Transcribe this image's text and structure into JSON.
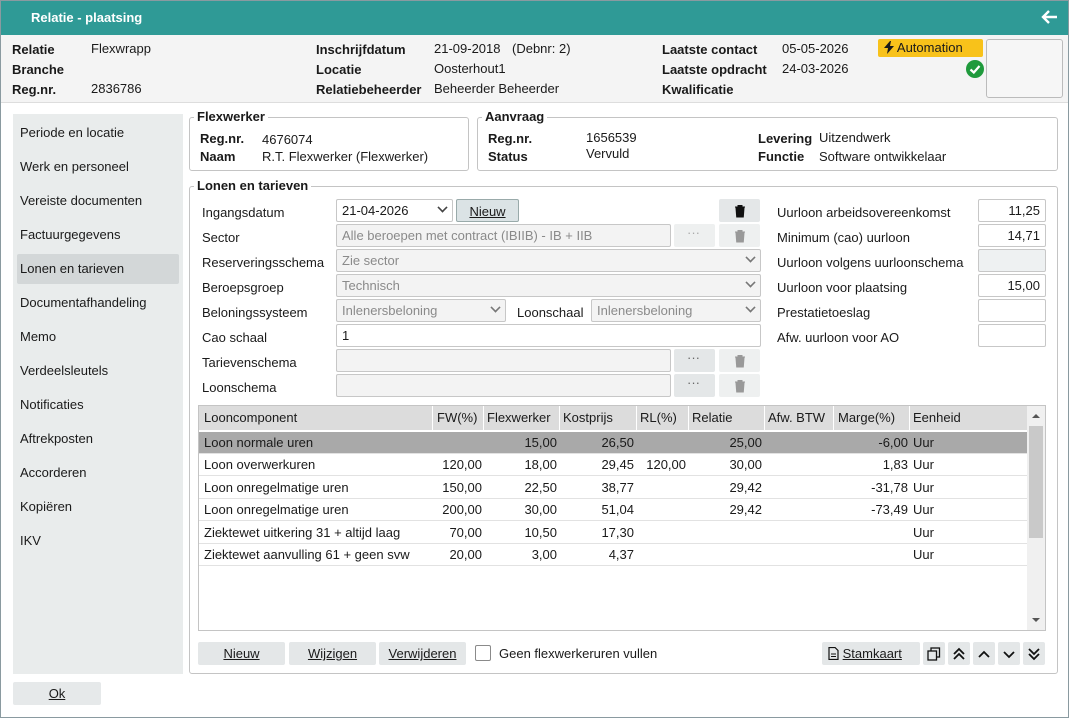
{
  "window": {
    "title": "Relatie - plaatsing"
  },
  "header": {
    "relatie_label": "Relatie",
    "relatie_value": "Flexwrapp",
    "branche_label": "Branche",
    "branche_value": "",
    "regnr_label": "Reg.nr.",
    "regnr_value": "2836786",
    "inschrijfdatum_label": "Inschrijfdatum",
    "inschrijfdatum_value": "21-09-2018",
    "debnr": "(Debnr: 2)",
    "locatie_label": "Locatie",
    "locatie_value": "Oosterhout1",
    "relatiebeheerder_label": "Relatiebeheerder",
    "relatiebeheerder_value": "Beheerder Beheerder",
    "laatste_contact_label": "Laatste contact",
    "laatste_contact_value": "05-05-2026",
    "laatste_opdracht_label": "Laatste opdracht",
    "laatste_opdracht_value": "24-03-2026",
    "kwalificatie_label": "Kwalificatie",
    "kwalificatie_value": "",
    "automation_label": "Automation"
  },
  "sidebar": {
    "items": [
      {
        "label": "Periode en locatie"
      },
      {
        "label": "Werk en personeel"
      },
      {
        "label": "Vereiste documenten"
      },
      {
        "label": "Factuurgegevens"
      },
      {
        "label": "Lonen en tarieven"
      },
      {
        "label": "Documentafhandeling"
      },
      {
        "label": "Memo"
      },
      {
        "label": "Verdeelsleutels"
      },
      {
        "label": "Notificaties"
      },
      {
        "label": "Aftrekposten"
      },
      {
        "label": "Accorderen"
      },
      {
        "label": "Kopiëren"
      },
      {
        "label": "IKV"
      }
    ],
    "ok_label": "Ok"
  },
  "flexwerker": {
    "legend": "Flexwerker",
    "regnr_label": "Reg.nr.",
    "regnr_value": "4676074",
    "naam_label": "Naam",
    "naam_value": "R.T. Flexwerker (Flexwerker)"
  },
  "aanvraag": {
    "legend": "Aanvraag",
    "regnr_label": "Reg.nr.",
    "regnr_value": "1656539",
    "status_label": "Status",
    "status_value": "Vervuld",
    "levering_label": "Levering",
    "levering_value": "Uitzendwerk",
    "functie_label": "Functie",
    "functie_value": "Software ontwikkelaar"
  },
  "lonen": {
    "legend": "Lonen en tarieven",
    "ingangsdatum_label": "Ingangsdatum",
    "ingangsdatum_value": "21-04-2026",
    "nieuw_label": "Nieuw",
    "sector_label": "Sector",
    "sector_value": "Alle beroepen met contract (IBIIB) - IB + IIB",
    "reservering_label": "Reserveringsschema",
    "reservering_value": "Zie sector",
    "beroepsgroep_label": "Beroepsgroep",
    "beroepsgroep_value": "Technisch",
    "beloning_label": "Beloningssysteem",
    "beloning_value": "Inlenersbeloning",
    "loonschaal_label": "Loonschaal",
    "loonschaal_value": "Inlenersbeloning",
    "cao_schaal_label": "Cao schaal",
    "cao_schaal_value": "1",
    "tarieven_label": "Tarievenschema",
    "tarieven_value": "",
    "loonschema_label": "Loonschema",
    "loonschema_value": "",
    "ellipsis": "···",
    "uurloon_cao_label": "Uurloon arbeidsovereenkomst",
    "uurloon_cao_value": "11,25",
    "minimum_label": "Minimum (cao) uurloon",
    "minimum_value": "14,71",
    "uurloon_schema_label": "Uurloon volgens uurloonschema",
    "uurloon_schema_value": "",
    "uurloon_plaatsing_label": "Uurloon voor plaatsing",
    "uurloon_plaatsing_value": "15,00",
    "prestatie_label": "Prestatietoeslag",
    "prestatie_value": "",
    "afw_label": "Afw. uurloon voor AO",
    "afw_value": ""
  },
  "table": {
    "columns": [
      "Looncomponent",
      "FW(%)",
      "Flexwerker",
      "Kostprijs",
      "RL(%)",
      "Relatie",
      "Afw. BTW",
      "Marge(%)",
      "Eenheid"
    ],
    "rows": [
      [
        "Loon normale uren",
        "",
        "15,00",
        "26,50",
        "",
        "25,00",
        "",
        "-6,00",
        "Uur"
      ],
      [
        "Loon overwerkuren",
        "120,00",
        "18,00",
        "29,45",
        "120,00",
        "30,00",
        "",
        "1,83",
        "Uur"
      ],
      [
        "Loon onregelmatige uren",
        "150,00",
        "22,50",
        "38,77",
        "",
        "29,42",
        "",
        "-31,78",
        "Uur"
      ],
      [
        "Loon onregelmatige uren",
        "200,00",
        "30,00",
        "51,04",
        "",
        "29,42",
        "",
        "-73,49",
        "Uur"
      ],
      [
        "Ziektewet uitkering 31 + altijd laag",
        "70,00",
        "10,50",
        "17,30",
        "",
        "",
        "",
        "",
        "Uur"
      ],
      [
        "Ziektewet aanvulling 61 +  geen svw",
        "20,00",
        "3,00",
        "4,37",
        "",
        "",
        "",
        "",
        "Uur"
      ]
    ]
  },
  "footer": {
    "nieuw_label": "Nieuw",
    "wijzigen_label": "Wijzigen",
    "verwijderen_label": "Verwijderen",
    "geen_label": "Geen flexwerkeruren vullen",
    "stamkaart_label": "Stamkaart"
  }
}
